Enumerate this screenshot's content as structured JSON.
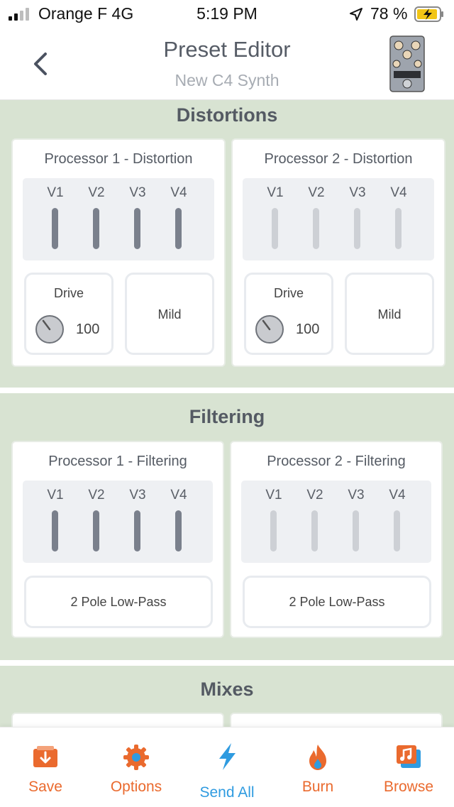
{
  "status_bar": {
    "carrier": "Orange F",
    "network": "4G",
    "time": "5:19 PM",
    "battery": "78 %"
  },
  "header": {
    "title": "Preset Editor",
    "subtitle": "New C4 Synth"
  },
  "distortions": {
    "title": "Distortions",
    "processors": [
      {
        "title": "Processor 1 - Distortion",
        "voices": [
          "V1",
          "V2",
          "V3",
          "V4"
        ],
        "voices_active": true,
        "knob_label": "Drive",
        "knob_value": "100",
        "mode": "Mild"
      },
      {
        "title": "Processor 2 - Distortion",
        "voices": [
          "V1",
          "V2",
          "V3",
          "V4"
        ],
        "voices_active": false,
        "knob_label": "Drive",
        "knob_value": "100",
        "mode": "Mild"
      }
    ]
  },
  "filtering": {
    "title": "Filtering",
    "processors": [
      {
        "title": "Processor 1 - Filtering",
        "voices": [
          "V1",
          "V2",
          "V3",
          "V4"
        ],
        "voices_active": true,
        "filter_type": "2 Pole Low-Pass"
      },
      {
        "title": "Processor 2 - Filtering",
        "voices": [
          "V1",
          "V2",
          "V3",
          "V4"
        ],
        "voices_active": false,
        "filter_type": "2 Pole Low-Pass"
      }
    ]
  },
  "mixes": {
    "title": "Mixes"
  },
  "tabbar": {
    "save": "Save",
    "options": "Options",
    "send_all": "Send All",
    "burn": "Burn",
    "browse": "Browse"
  },
  "colors": {
    "section_bg": "#d8e3d2",
    "tab_accent": "#ea6a2e",
    "send_all_accent": "#2f9be0",
    "slider_active": "#7a808c",
    "slider_inactive": "#cdd0d5"
  }
}
